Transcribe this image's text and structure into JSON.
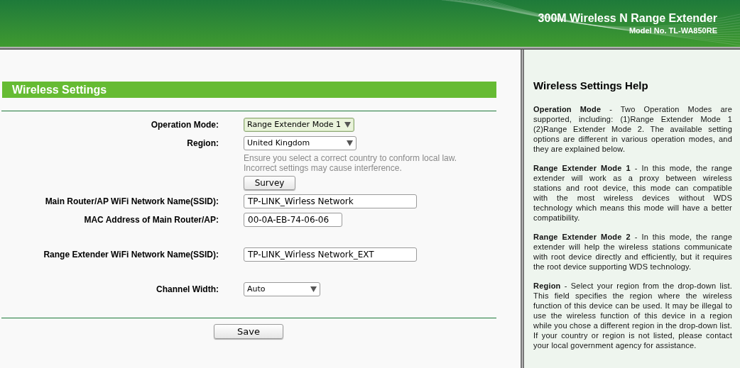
{
  "header": {
    "title": "300M Wireless N Range Extender",
    "model": "Model No. TL-WA850RE"
  },
  "section_title": "Wireless Settings",
  "groups": [
    [
      {
        "kind": "select",
        "label": "Operation Mode:",
        "value": "Range Extender Mode 1",
        "highlighted": true
      },
      {
        "kind": "select",
        "label": "Region:",
        "value": "United Kingdom",
        "highlighted": false,
        "notes": [
          "Ensure you select a correct country to conform local law.",
          "Incorrect settings may cause interference."
        ],
        "button": "Survey"
      },
      {
        "kind": "text",
        "label": "Main Router/AP WiFi Network Name(SSID):",
        "value": "TP-LINK_Wirless Network"
      },
      {
        "kind": "text",
        "label": "MAC Address of Main Router/AP:",
        "value": "00-0A-EB-74-06-06"
      }
    ],
    [
      {
        "kind": "text",
        "label": "Range Extender WiFi Network Name(SSID):",
        "value": "TP-LINK_Wirless Network_EXT"
      }
    ],
    [
      {
        "kind": "select",
        "label": "Channel Width:",
        "value": "Auto",
        "highlighted": false
      }
    ]
  ],
  "save_button": "Save",
  "help": {
    "title": "Wireless Settings Help",
    "paragraphs": [
      "**Operation Mode** - Two Operation Modes are supported, including: (1)Range Extender Mode 1 (2)Range Extender Mode 2. The available setting options are different in various operation modes, and they are explained below.",
      "**Range Extender Mode 1** - In this mode, the range extender will work as a proxy between wireless stations and root device, this mode can compatible with the most wireless devices without WDS technology which means this mode will have a better compatibility.",
      "**Range Extender Mode 2** - In this mode, the range extender will help the wireless stations communicate with root device directly and efficiently, but it requires the root device supporting WDS technology.",
      "**Region** - Select your region from the drop-down list. This field specifies the region where the wireless function of this device can be used. It may be illegal to use the wireless function of this device in a region while you chose a different region in the drop-down list. If your country or region is not listed, please contact your local government agency for assistance."
    ]
  }
}
